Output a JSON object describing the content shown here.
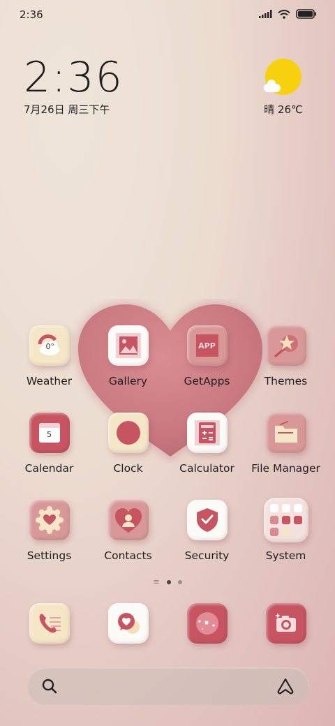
{
  "status_bar": {
    "time": "2:36"
  },
  "clock_widget": {
    "time": "2:36",
    "date": "7月26日 周三下午"
  },
  "weather_widget": {
    "condition": "晴",
    "temperature": "26℃",
    "text": "晴 26℃"
  },
  "apps": {
    "row1": [
      "Weather",
      "Gallery",
      "GetApps",
      "Themes"
    ],
    "row2": [
      "Calendar",
      "Clock",
      "Calculator",
      "File Manager"
    ],
    "row3": [
      "Settings",
      "Contacts",
      "Security",
      "System"
    ]
  },
  "weather_icon_temp": "0°",
  "getapps_icon_text": "APP",
  "calendar_icon_day": "5",
  "dock": [
    "phone-icon",
    "messages-icon",
    "browser-icon",
    "camera-icon"
  ],
  "colors": {
    "accent_red": "#c65561",
    "cream": "#f5e6c8",
    "rose": "#d89898",
    "sun": "#f7d10e"
  }
}
